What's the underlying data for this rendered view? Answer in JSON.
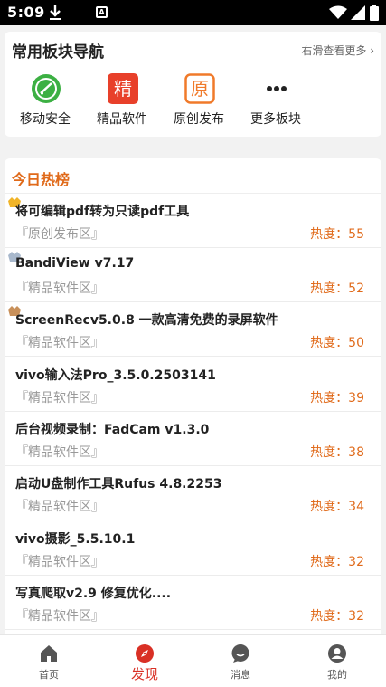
{
  "status": {
    "time": "5:09",
    "app_icon_letter": "A"
  },
  "nav": {
    "title": "常用板块导航",
    "more": "右滑查看更多",
    "items": [
      {
        "label": "移动安全",
        "icon": "shield-check-icon"
      },
      {
        "label": "精品软件",
        "icon": "jing-badge-icon",
        "glyph": "精"
      },
      {
        "label": "原创发布",
        "icon": "yuan-badge-icon",
        "glyph": "原"
      },
      {
        "label": "更多板块",
        "icon": "more-dots-icon"
      }
    ]
  },
  "hot": {
    "title": "今日热榜",
    "items": [
      {
        "title": "将可编辑pdf转为只读pdf工具",
        "category": "『原创发布区』",
        "heat": "热度：55",
        "medal": "gold"
      },
      {
        "title": "BandiView v7.17",
        "category": "『精品软件区』",
        "heat": "热度：52",
        "medal": "silver"
      },
      {
        "title": "ScreenRecv5.0.8 一款高清免费的录屏软件",
        "category": "『精品软件区』",
        "heat": "热度：50",
        "medal": "bronze"
      },
      {
        "title": "vivo输入法Pro_3.5.0.2503141",
        "category": "『精品软件区』",
        "heat": "热度：39"
      },
      {
        "title": "后台视频录制：FadCam v1.3.0",
        "category": "『精品软件区』",
        "heat": "热度：38"
      },
      {
        "title": "启动U盘制作工具Rufus 4.8.2253",
        "category": "『精品软件区』",
        "heat": "热度：34"
      },
      {
        "title": "vivo摄影_5.5.10.1",
        "category": "『精品软件区』",
        "heat": "热度：32"
      },
      {
        "title": "写真爬取v2.9 修复优化....",
        "category": "『精品软件区』",
        "heat": "热度：32"
      }
    ]
  },
  "tabs": [
    {
      "label": "首页",
      "icon": "home-icon"
    },
    {
      "label": "发现",
      "icon": "compass-icon",
      "active": true
    },
    {
      "label": "消息",
      "icon": "message-icon"
    },
    {
      "label": "我的",
      "icon": "profile-icon"
    }
  ],
  "colors": {
    "accent": "#e06a1a",
    "active_tab": "#d93025",
    "jing_bg": "#e8402a",
    "yuan_border": "#f07a2a",
    "shield": "#3cb043"
  }
}
